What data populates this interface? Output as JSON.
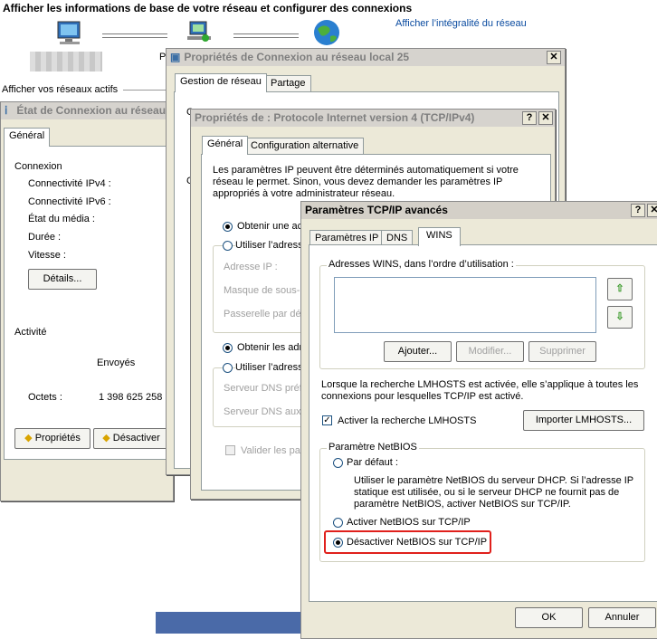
{
  "background": {
    "header_title": "Afficher les informations de base de votre réseau et configurer des connexions",
    "full_map_link": "Afficher l’intégralité du réseau",
    "p_fragment": "P",
    "active_networks": "Afficher vos réseaux actifs"
  },
  "status_window": {
    "title": "État de Connexion au réseau l",
    "tab_general": "Général",
    "connexion_section": "Connexion",
    "ipv4": "Connectivité IPv4 :",
    "ipv6": "Connectivité IPv6 :",
    "media": "État du média :",
    "duration": "Durée :",
    "speed": "Vitesse :",
    "details_btn": "Détails...",
    "activity_section": "Activité",
    "sent": "Envoyés",
    "bytes_label": "Octets :",
    "bytes_value": "1 398 625 258",
    "properties_btn": "Propriétés",
    "disable_btn": "Désactiver"
  },
  "props_window": {
    "title": "Propriétés de Connexion au réseau local 25",
    "tab_network": "Gestion de réseau",
    "tab_sharing": "Partage",
    "frag_c1": "C",
    "frag_c2": "C"
  },
  "ipv4_window": {
    "title": "Propriétés de : Protocole Internet version 4 (TCP/IPv4)",
    "tab_general": "Général",
    "tab_alt": "Configuration alternative",
    "intro_line1": "Les paramètres IP peuvent être déterminés automatiquement si votre",
    "intro_line2": "réseau le permet. Sinon, vous devez demander les paramètres IP",
    "intro_line3": "appropriés à votre administrateur réseau.",
    "auto_ip": "Obtenir une ac",
    "manual_ip": "Utiliser l’adress",
    "ip_address": "Adresse IP :",
    "subnet": "Masque de sous-r",
    "gateway": "Passerelle par déf",
    "auto_dns": "Obtenir les adr",
    "manual_dns": "Utiliser l’adress",
    "dns_pref": "Serveur DNS préf",
    "dns_aux": "Serveur DNS auxi",
    "validate": "Valider les par"
  },
  "advanced_window": {
    "title": "Paramètres TCP/IP avancés",
    "tabs": [
      "Paramètres IP",
      "DNS",
      "WINS"
    ],
    "wins_group": "Adresses WINS, dans l’ordre d’utilisation :",
    "add_btn": "Ajouter...",
    "modify_btn": "Modifier...",
    "delete_btn": "Supprimer",
    "lmhosts_line1": "Lorsque la recherche LMHOSTS est activée, elle s’applique à toutes les",
    "lmhosts_line2": "connexions pour lesquelles TCP/IP est activé.",
    "lmhosts_check": "Activer la recherche LMHOSTS",
    "import_btn": "Importer LMHOSTS...",
    "netbios_group": "Paramètre NetBIOS",
    "default_opt": "Par défaut :",
    "default_desc1": "Utiliser le paramètre NetBIOS du serveur DHCP. Si l’adresse IP",
    "default_desc2": "statique est utilisée, ou si le serveur DHCP ne fournit pas de",
    "default_desc3": "paramètre NetBIOS, activer NetBIOS sur TCP/IP.",
    "enable_opt": "Activer NetBIOS sur TCP/IP",
    "disable_opt": "Désactiver NetBIOS sur TCP/IP",
    "ok_btn": "OK",
    "cancel_btn": "Annuler"
  },
  "colors": {
    "highlight": "#e0201c",
    "arrow_green": "#3a9a2a",
    "link": "#0a4ba0"
  }
}
